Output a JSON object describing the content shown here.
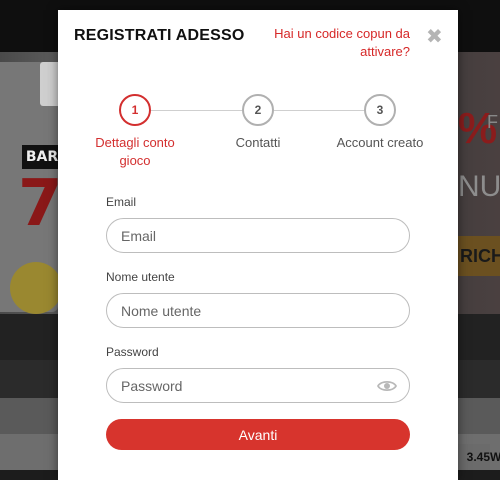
{
  "background": {
    "hero_tokens": {
      "bar": "BAR",
      "seven": "7",
      "pct": "%",
      "f": "F",
      "nu": "NU",
      "rich": "RICH"
    },
    "odds": [
      "3.45",
      "W"
    ]
  },
  "modal": {
    "title": "REGISTRATI ADESSO",
    "coupon_link": "Hai un codice copun da attivare?",
    "close_icon": "close-icon"
  },
  "steps": [
    {
      "number": "1",
      "label": "Dettagli conto gioco",
      "active": true
    },
    {
      "number": "2",
      "label": "Contatti",
      "active": false
    },
    {
      "number": "3",
      "label": "Account creato",
      "active": false
    }
  ],
  "form": {
    "email": {
      "label": "Email",
      "placeholder": "Email",
      "value": ""
    },
    "username": {
      "label": "Nome utente",
      "placeholder": "Nome utente",
      "value": ""
    },
    "password": {
      "label": "Password",
      "placeholder": "Password",
      "value": "",
      "toggle_icon": "eye-icon"
    },
    "submit_label": "Avanti"
  },
  "colors": {
    "accent": "#d32f2f",
    "button": "#d7342d"
  }
}
